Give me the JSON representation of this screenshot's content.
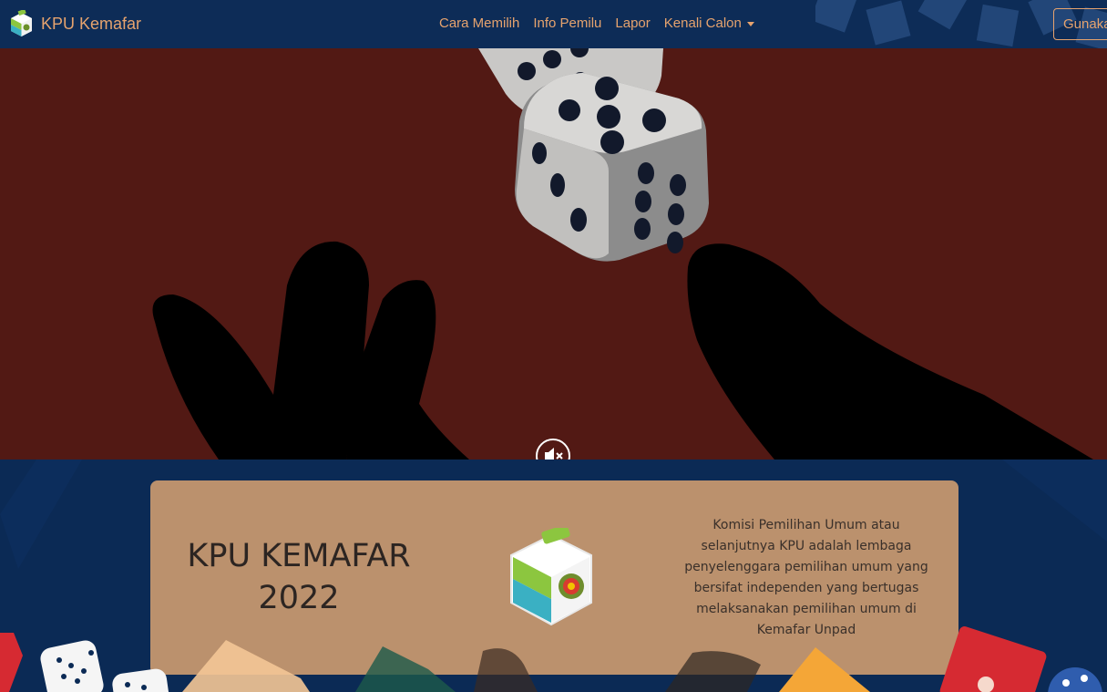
{
  "navbar": {
    "brand": "KPU Kemafar",
    "links": [
      {
        "label": "Cara Memilih"
      },
      {
        "label": "Info Pemilu"
      },
      {
        "label": "Lapor"
      },
      {
        "label": "Kenali Calon"
      }
    ],
    "button_label": "Gunakan"
  },
  "hero": {
    "mute_icon": "speaker-mute-icon"
  },
  "about": {
    "title_line1": "KPU KEMAFAR",
    "title_line2": "2022",
    "description": "Komisi Pemilihan Umum atau selanjutnya KPU adalah lembaga penyelenggara pemilihan umum yang bersifat independen yang bertugas melaksanakan pemilihan umum di Kemafar Unpad"
  },
  "colors": {
    "navbar_bg": "#0d2c57",
    "accent": "#e6a36e",
    "hero_bg": "#521914",
    "card_bg": "#bb916d"
  }
}
